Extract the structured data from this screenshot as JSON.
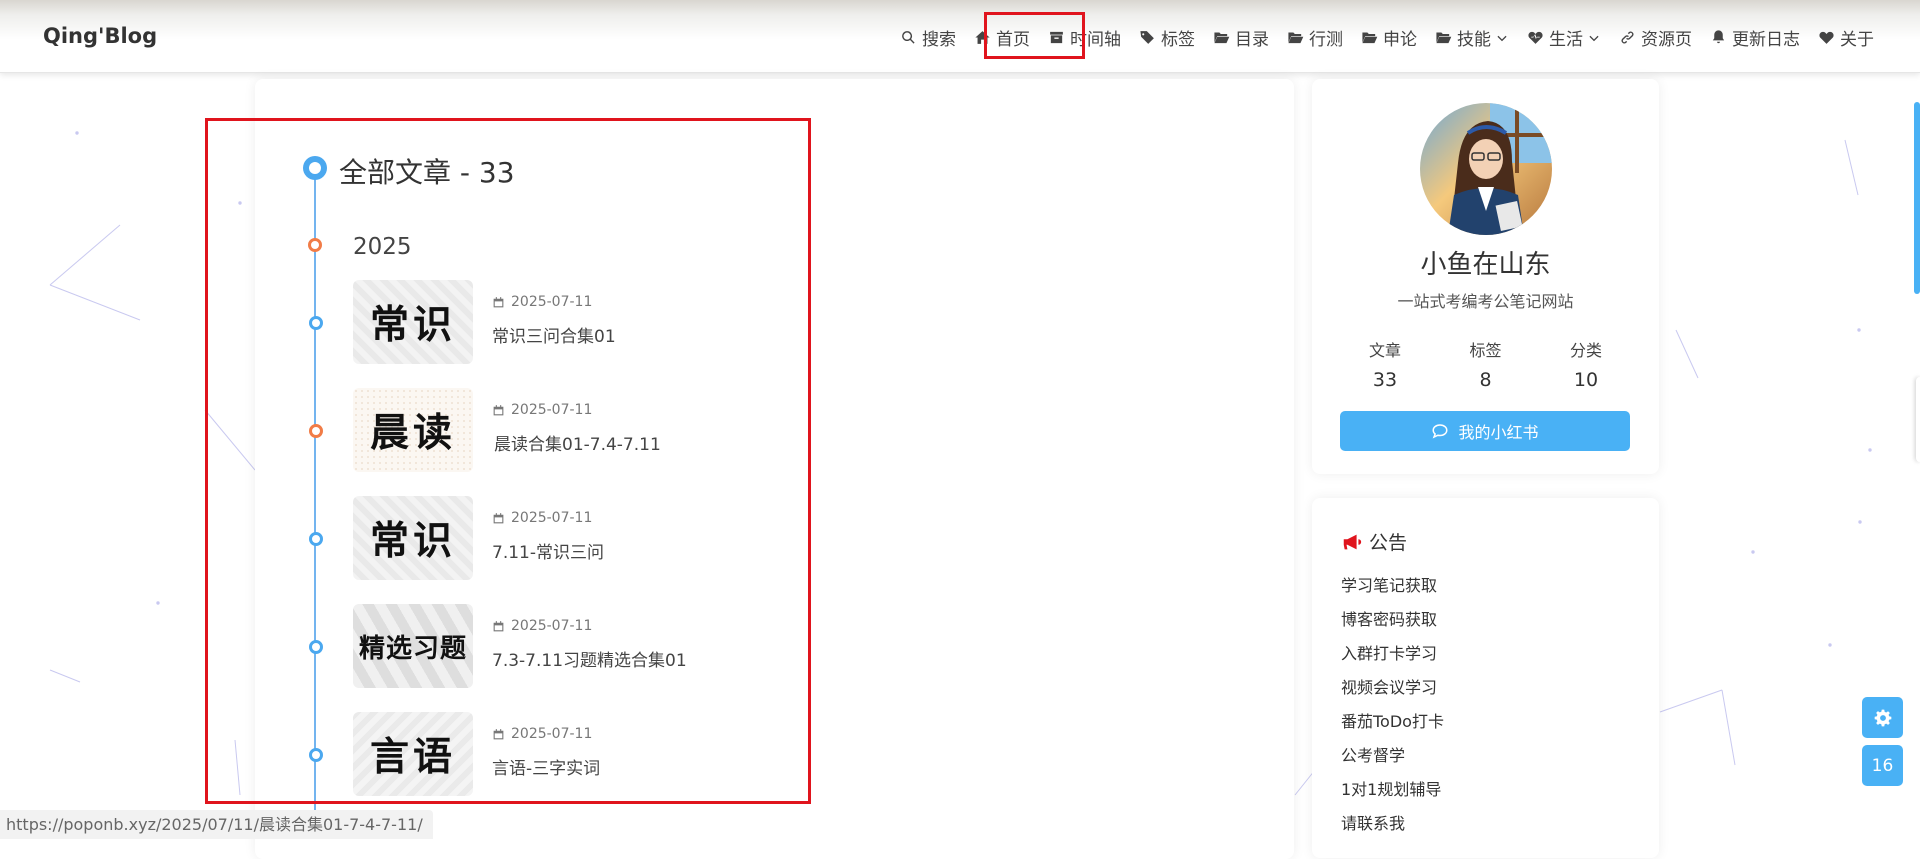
{
  "header": {
    "logo": "Qing'Blog",
    "nav": [
      {
        "label": "搜索",
        "icon": "search-icon"
      },
      {
        "label": "首页",
        "icon": "home-icon"
      },
      {
        "label": "时间轴",
        "icon": "archive-icon"
      },
      {
        "label": "标签",
        "icon": "tags-icon"
      },
      {
        "label": "目录",
        "icon": "folder-open-icon"
      },
      {
        "label": "行测",
        "icon": "folder-open-icon"
      },
      {
        "label": "申论",
        "icon": "folder-open-icon"
      },
      {
        "label": "技能",
        "icon": "folder-open-icon",
        "dropdown": true
      },
      {
        "label": "生活",
        "icon": "heartbeat-icon",
        "dropdown": true
      },
      {
        "label": "资源页",
        "icon": "link-icon"
      },
      {
        "label": "更新日志",
        "icon": "bell-icon"
      },
      {
        "label": "关于",
        "icon": "heart-icon"
      }
    ]
  },
  "timeline": {
    "title": "全部文章 - 33",
    "year": "2025",
    "posts": [
      {
        "thumb_text": "常识",
        "date": "2025-07-11",
        "title": "常识三问合集01"
      },
      {
        "thumb_text": "晨读",
        "date": "2025-07-11",
        "title": "晨读合集01-7.4-7.11"
      },
      {
        "thumb_text": "常识",
        "date": "2025-07-11",
        "title": "7.11-常识三问"
      },
      {
        "thumb_text": "精选习题",
        "date": "2025-07-11",
        "title": "7.3-7.11习题精选合集01"
      },
      {
        "thumb_text": "言语",
        "date": "2025-07-11",
        "title": "言语-三字实词"
      }
    ]
  },
  "profile": {
    "name": "小鱼在山东",
    "description": "一站式考编考公笔记网站",
    "stats": [
      {
        "label": "文章",
        "value": "33"
      },
      {
        "label": "标签",
        "value": "8"
      },
      {
        "label": "分类",
        "value": "10"
      }
    ],
    "button_label": "我的小红书"
  },
  "announcement": {
    "title": "公告",
    "links": [
      "学习笔记获取",
      "博客密码获取",
      "入群打卡学习",
      "视频会议学习",
      "番茄ToDo打卡",
      "公考督学",
      "1对1规划辅导",
      "请联系我"
    ]
  },
  "floating": {
    "settings_icon": "gear-icon",
    "counter": "16"
  },
  "status_bar": {
    "url": "https://poponb.xyz/2025/07/11/晨读合集01-7-4-7-11/"
  },
  "colors": {
    "accent": "#49b1f5",
    "highlight": "#e0141d",
    "timeline_orange": "#f17c47"
  }
}
